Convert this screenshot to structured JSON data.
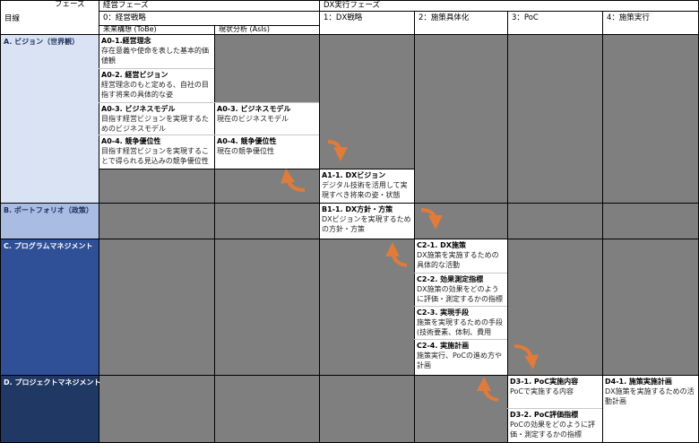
{
  "header": {
    "phase_label": "フェーズ",
    "objective_label": "目線",
    "management_phase": "経営フェーズ",
    "dx_phase": "DX実行フェーズ",
    "col0": "0：経営戦略",
    "col0a": "未来構想 (ToBe)",
    "col0b": "現状分析 (AsIs)",
    "col1": "1：DX戦略",
    "col2": "2：施策具体化",
    "col3": "3：PoC",
    "col4": "4：施策実行"
  },
  "rows": {
    "a": "A. ビジョン（世界観）",
    "b": "B. ポートフォリオ（政策）",
    "c": "C. プログラムマネジメント",
    "d": "D. プロジェクトマネジメント"
  },
  "cells": {
    "a0_1": {
      "title": "A0-1.経営理念",
      "desc": "存在意義や使命を表した基本的価値観"
    },
    "a0_2": {
      "title": "A0-2. 経営ビジョン",
      "desc": "経営理念のもと定める、自社の目指す将来の具体的な姿"
    },
    "a0_3": {
      "title": "A0-3. ビジネスモデル",
      "desc": "目指す経営ビジョンを実現するためのビジネスモデル"
    },
    "a0_3b": {
      "title": "A0-3. ビジネスモデル",
      "desc": "現在のビジネスモデル"
    },
    "a0_4": {
      "title": "A0-4. 競争優位性",
      "desc": "目指す経営ビジョンを実現することで得られる見込みの競争優位性"
    },
    "a0_4b": {
      "title": "A0-4. 競争優位性",
      "desc": "現在の競争優位性"
    },
    "a1_1": {
      "title": "A1-1. DXビジョン",
      "desc": "デジタル技術を活用して実現すべき将来の姿・状態"
    },
    "b1_1": {
      "title": "B1-1. DX方針・方策",
      "desc": "DXビジョンを実現するための方針・方策"
    },
    "c2_1": {
      "title": "C2-1. DX施策",
      "desc": "DX施策を実施するための具体的な活動"
    },
    "c2_2": {
      "title": "C2-2. 効果測定指標",
      "desc": "DX施策の効果をどのように評価・測定するかの指標"
    },
    "c2_3": {
      "title": "C2-3. 実現手段",
      "desc": "施策を実現するための手段(技術要素、体制、費用"
    },
    "c2_4": {
      "title": "C2-4. 実施計画",
      "desc": "施策実行、PoCの進め方や計画"
    },
    "d3_1": {
      "title": "D3-1. PoC実施内容",
      "desc": "PoCで実施する内容"
    },
    "d3_2": {
      "title": "D3-2. PoC評価指標",
      "desc": "PoCの効果をどのように評価・測定するかの指標"
    },
    "d4_1": {
      "title": "D4-1. 施策実施計画",
      "desc": "DX施策を実施するための活動計画"
    }
  },
  "colors": {
    "row_a": "#dae3f3",
    "row_b": "#a9bde3",
    "row_c": "#2f4f97",
    "row_d": "#203864",
    "grey_cell": "#7f7f7f",
    "arrow": "#e07b39"
  }
}
